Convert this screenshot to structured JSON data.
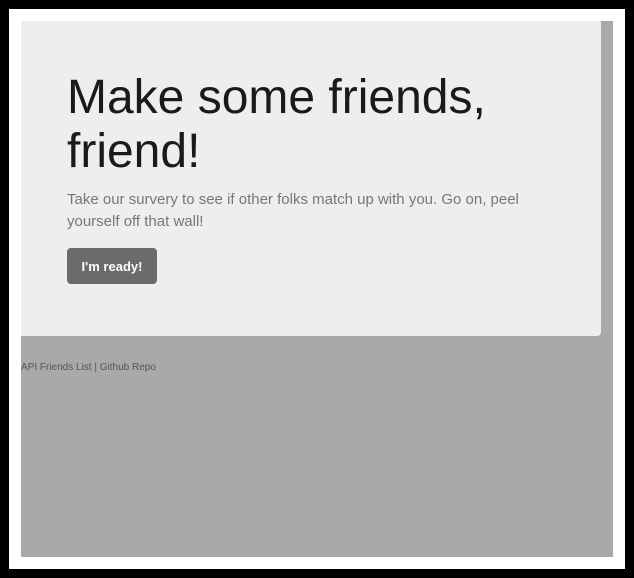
{
  "jumbotron": {
    "headline": "Make some friends, friend!",
    "lead": "Take our survery to see if other folks match up with you. Go on, peel yourself off that wall!",
    "button_label": "I'm ready!"
  },
  "footer": {
    "friends_link": "API Friends List",
    "separator": "|",
    "repo_link": "Github Repo"
  }
}
